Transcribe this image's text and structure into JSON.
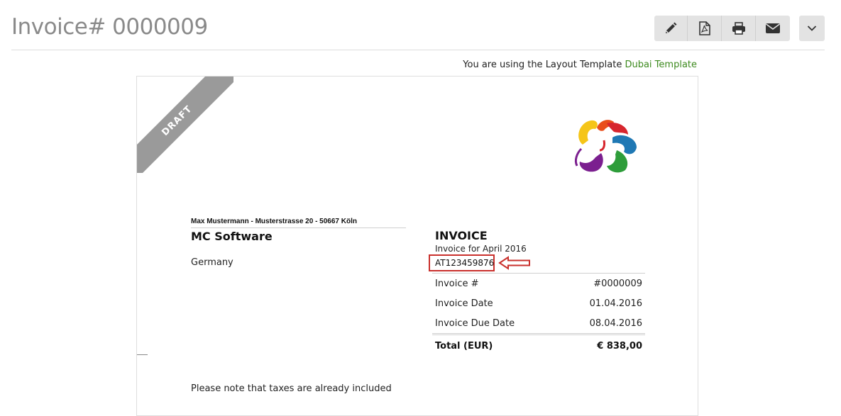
{
  "header": {
    "title": "Invoice# 0000009"
  },
  "toolbar": {
    "buttons": [
      {
        "icon": "pencil-icon"
      },
      {
        "icon": "pdf-icon"
      },
      {
        "icon": "print-icon"
      },
      {
        "icon": "envelope-icon"
      }
    ],
    "dropdown_icon": "chevron-down-icon"
  },
  "template_notice": {
    "text": "You are using the Layout Template ",
    "link_label": "Dubai Template"
  },
  "invoice": {
    "ribbon": "DRAFT",
    "sender_line": "Max Mustermann - Musterstrasse 20 - 50667 Köln",
    "recipient": {
      "name": "MC Software",
      "country": "Germany"
    },
    "heading": "INVOICE",
    "subject": "Invoice for April 2016",
    "vat_id": "AT123459876",
    "meta": [
      {
        "label": "Invoice #",
        "value": "#0000009"
      },
      {
        "label": "Invoice Date",
        "value": "01.04.2016"
      },
      {
        "label": "Invoice Due Date",
        "value": "08.04.2016"
      }
    ],
    "total": {
      "label": "Total (EUR)",
      "value": "€ 838,00"
    },
    "note": "Please note that taxes are already included"
  },
  "colors": {
    "link": "#3d8a1e",
    "highlight": "#c9302c",
    "ribbon": "#9a9a9a"
  }
}
